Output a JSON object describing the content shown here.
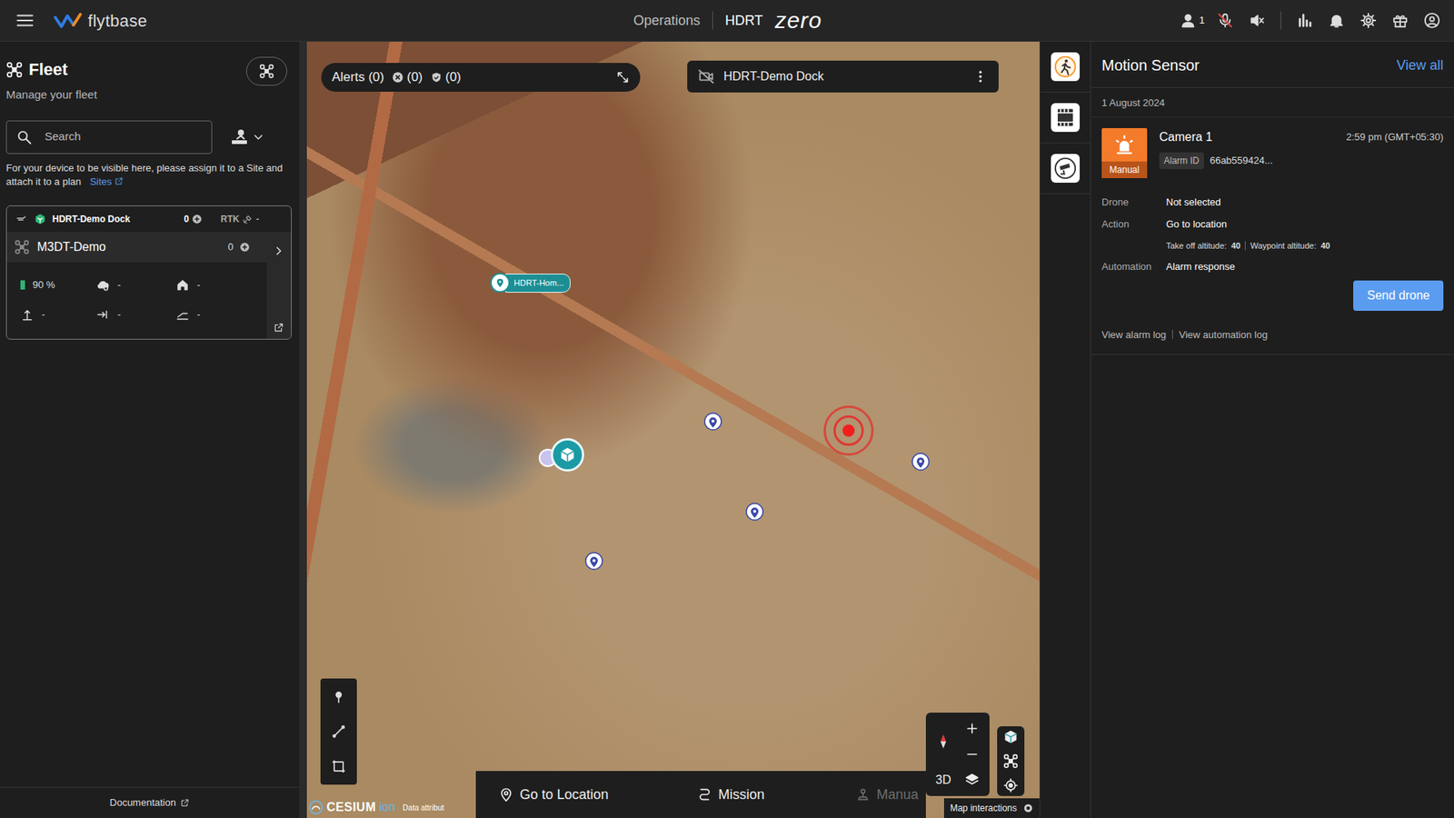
{
  "topbar": {
    "logo": "flytbase",
    "nav": "Operations",
    "site": "HDRT",
    "brand": "zero",
    "online_users": "1",
    "mic_muted": true,
    "sound_muted": true
  },
  "fleet": {
    "title": "Fleet",
    "subtitle": "Manage your fleet",
    "search": {
      "placeholder": "Search"
    },
    "notice": "For your device to be visible here, please assign it to a Site and attach it to a plan",
    "notice_link": "Sites",
    "devices": [
      {
        "dock": {
          "name": "HDRT-Demo Dock",
          "count": "0",
          "rtk_label": "RTK",
          "rtk_value": "-"
        },
        "drone": {
          "name": "M3DT-Demo",
          "count": "0",
          "battery": "90 %",
          "battery_level": 0.9,
          "stats": [
            {
              "kind": "weather",
              "value": "-"
            },
            {
              "kind": "home",
              "value": "-"
            },
            {
              "kind": "altitude",
              "value": "-"
            },
            {
              "kind": "speed",
              "value": "-"
            },
            {
              "kind": "distance",
              "value": "-"
            }
          ]
        }
      }
    ],
    "documentation": "Documentation"
  },
  "map": {
    "alerts": {
      "label": "Alerts (0)",
      "counts": [
        {
          "kind": "error",
          "value": "(0)"
        },
        {
          "kind": "shield",
          "value": "(0)"
        }
      ]
    },
    "dock_bar": {
      "name": "HDRT-Demo Dock"
    },
    "markers": [
      {
        "kind": "home",
        "label": "HDRT-Hom..."
      },
      {
        "kind": "dock"
      },
      {
        "kind": "waypoint"
      },
      {
        "kind": "waypoint"
      },
      {
        "kind": "waypoint"
      },
      {
        "kind": "waypoint"
      },
      {
        "kind": "alarm"
      }
    ],
    "actions": [
      {
        "label": "Go to Location",
        "kind": "location",
        "disabled": false
      },
      {
        "label": "Mission",
        "kind": "mission",
        "disabled": false
      },
      {
        "label": "Manua",
        "kind": "manual",
        "disabled": true
      }
    ],
    "view_mode": "3D",
    "attribution": {
      "logo": "CESIUM",
      "ion": "ion",
      "data": "Data attribut"
    },
    "interactions": "Map interactions"
  },
  "alarm_sources": [
    {
      "kind": "motion"
    },
    {
      "kind": "film"
    },
    {
      "kind": "cctv"
    }
  ],
  "alarm_panel": {
    "title": "Motion Sensor",
    "view_all": "View all",
    "date": "1 August 2024",
    "alarms": [
      {
        "source": "Camera 1",
        "time": "2:59 pm (GMT+05:30)",
        "badge": "Manual",
        "alarm_id_label": "Alarm ID",
        "alarm_id": "66ab559424...",
        "details": [
          {
            "label": "Drone",
            "value": "Not selected"
          },
          {
            "label": "Action",
            "value": "Go to location"
          }
        ],
        "altitudes": [
          {
            "label": "Take off altitude:",
            "value": "40"
          },
          {
            "label": "Waypoint altitude:",
            "value": "40"
          }
        ],
        "automation": {
          "label": "Automation",
          "value": "Alarm response"
        },
        "button": "Send drone",
        "links": [
          "View alarm log",
          "View automation log"
        ]
      }
    ]
  }
}
